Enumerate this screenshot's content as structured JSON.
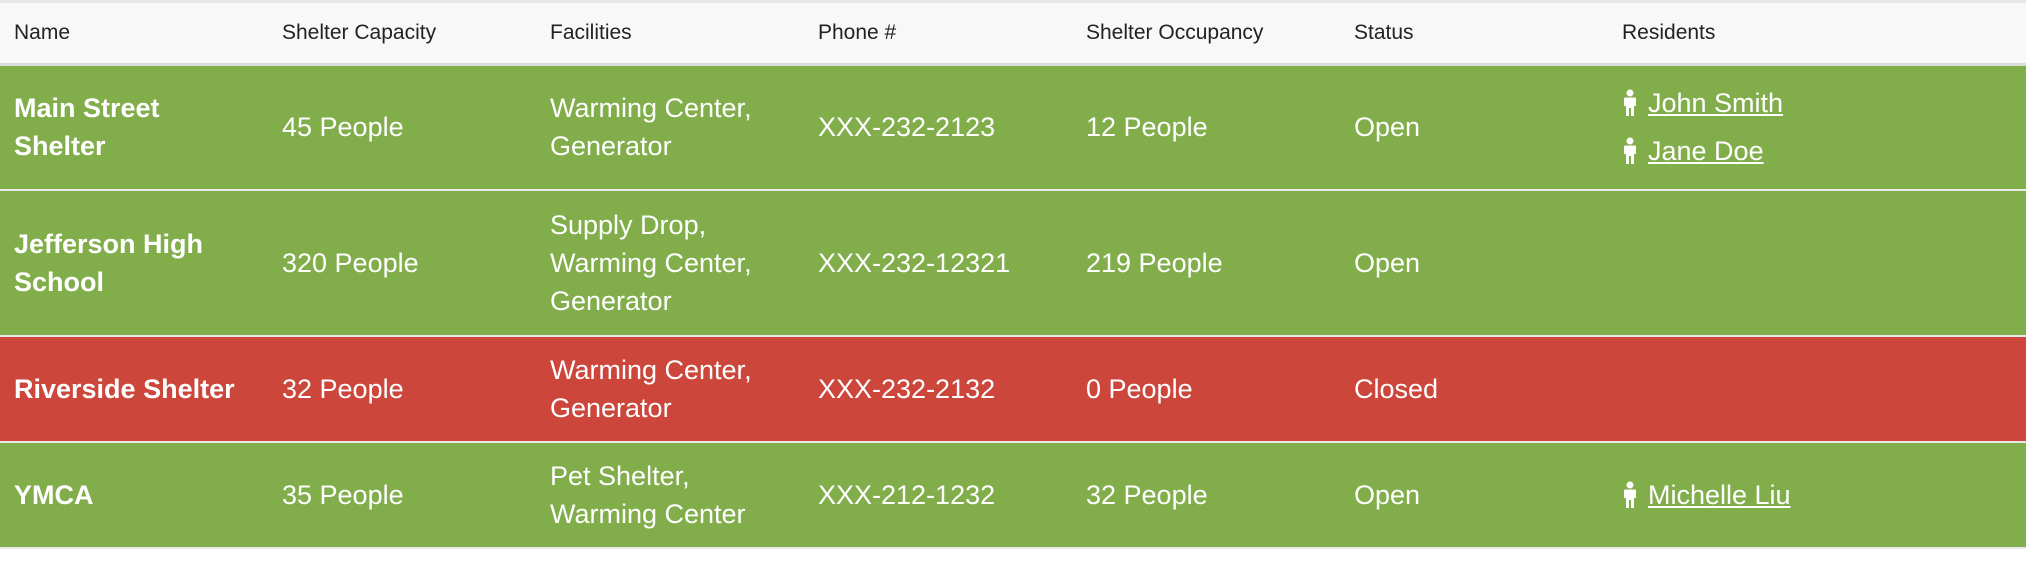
{
  "table": {
    "headers": [
      "Name",
      "Shelter Capacity",
      "Facilities",
      "Phone #",
      "Shelter Occupancy",
      "Status",
      "Residents"
    ],
    "rows": [
      {
        "name": "Main Street Shelter",
        "capacity": "45 People",
        "facilities": "Warming Center, Generator",
        "phone": "XXX-232-2123",
        "occupancy": "12 People",
        "status": "Open",
        "residents": [
          " John Smith",
          " Jane Doe"
        ]
      },
      {
        "name": "Jefferson High School",
        "capacity": "320 People",
        "facilities": "Supply Drop, Warming Center, Generator",
        "phone": "XXX-232-12321",
        "occupancy": "219 People",
        "status": "Open",
        "residents": []
      },
      {
        "name": "Riverside Shelter",
        "capacity": "32 People",
        "facilities": "Warming Center, Generator",
        "phone": "XXX-232-2132",
        "occupancy": "0 People",
        "status": "Closed",
        "residents": []
      },
      {
        "name": "YMCA",
        "capacity": "35 People",
        "facilities": "Pet Shelter, Warming Center",
        "phone": "XXX-212-1232",
        "occupancy": "32 People",
        "status": "Open",
        "residents": [
          " Michelle Liu"
        ]
      }
    ]
  },
  "colors": {
    "open_row": "#82ad4b",
    "closed_row": "#cc463b",
    "header_bg": "#f8f8f8"
  },
  "icons": {
    "resident": "person-icon"
  }
}
